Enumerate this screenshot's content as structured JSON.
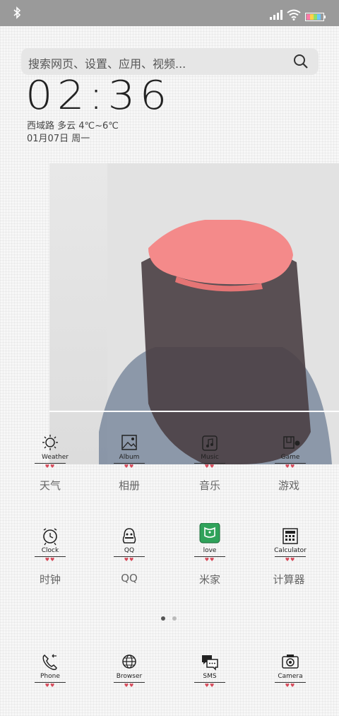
{
  "search": {
    "placeholder": "搜索网页、设置、应用、视频..."
  },
  "clock": {
    "time": "02:36"
  },
  "weather": {
    "line": "西域路  多云  4℃~6℃"
  },
  "date": {
    "line": "01月07日 周一"
  },
  "apps_row1": [
    {
      "hand": "Weather",
      "label": "天气",
      "icon": "weather-icon"
    },
    {
      "hand": "Album",
      "label": "相册",
      "icon": "album-icon"
    },
    {
      "hand": "Music",
      "label": "音乐",
      "icon": "music-icon"
    },
    {
      "hand": "Game",
      "label": "游戏",
      "icon": "game-icon"
    }
  ],
  "apps_row2": [
    {
      "hand": "Clock",
      "label": "时钟",
      "icon": "clock-icon"
    },
    {
      "hand": "QQ",
      "label": "QQ",
      "icon": "qq-icon"
    },
    {
      "hand": "love",
      "label": "米家",
      "icon": "mijia-icon"
    },
    {
      "hand": "Calculator",
      "label": "计算器",
      "icon": "calculator-icon"
    }
  ],
  "dock": [
    {
      "hand": "Phone",
      "icon": "phone-icon"
    },
    {
      "hand": "Browser",
      "icon": "browser-icon"
    },
    {
      "hand": "SMS",
      "icon": "sms-icon"
    },
    {
      "hand": "Camera",
      "icon": "camera-icon"
    }
  ],
  "page_indicator": {
    "count": 2,
    "active": 0
  },
  "colors": {
    "statusbar": "#9a9a9a",
    "hearts": "#d74a5a",
    "mijia": "#2fa25a",
    "hat": "#f48a8a"
  }
}
